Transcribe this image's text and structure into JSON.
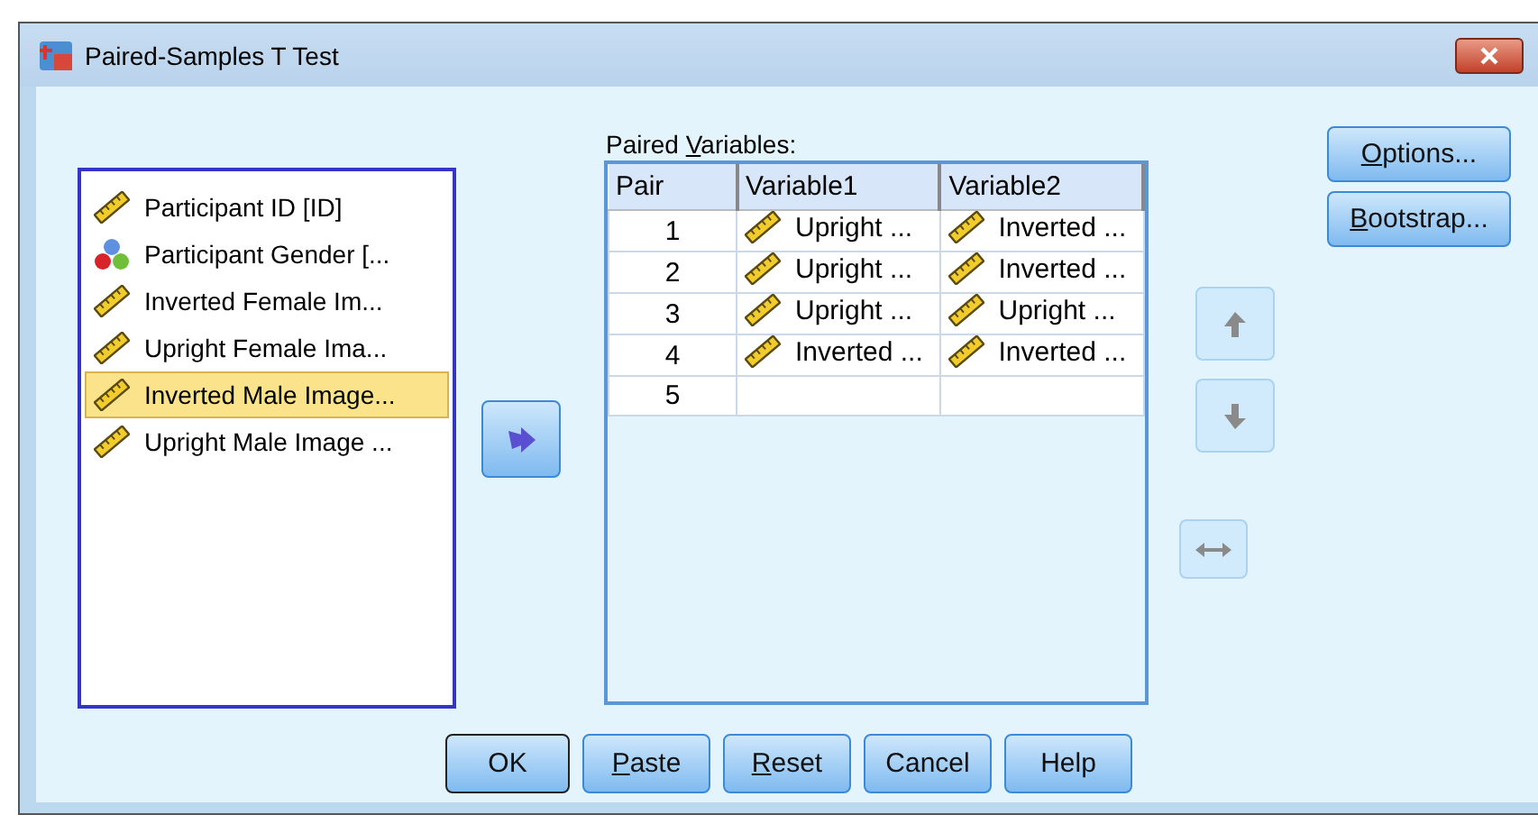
{
  "window": {
    "title": "Paired-Samples T Test"
  },
  "variables": [
    {
      "label": "Participant ID [ID]",
      "kind": "scale",
      "selected": false
    },
    {
      "label": "Participant Gender [...",
      "kind": "nominal",
      "selected": false
    },
    {
      "label": "Inverted Female Im...",
      "kind": "scale",
      "selected": false
    },
    {
      "label": "Upright Female Ima...",
      "kind": "scale",
      "selected": false
    },
    {
      "label": "Inverted Male Image...",
      "kind": "scale",
      "selected": true
    },
    {
      "label": "Upright Male Image ...",
      "kind": "scale",
      "selected": false
    }
  ],
  "paired_variables": {
    "label": {
      "pre": "Paired ",
      "key": "V",
      "post": "ariables:"
    },
    "columns": [
      "Pair",
      "Variable1",
      "Variable2"
    ],
    "rows": [
      [
        {
          "text": "1"
        },
        {
          "text": "Upright ...",
          "kind": "scale"
        },
        {
          "text": "Inverted ...",
          "kind": "scale"
        }
      ],
      [
        {
          "text": "2"
        },
        {
          "text": "Upright ...",
          "kind": "scale"
        },
        {
          "text": "Inverted ...",
          "kind": "scale"
        }
      ],
      [
        {
          "text": "3"
        },
        {
          "text": "Upright ...",
          "kind": "scale"
        },
        {
          "text": "Upright ...",
          "kind": "scale"
        }
      ],
      [
        {
          "text": "4"
        },
        {
          "text": "Inverted ...",
          "kind": "scale"
        },
        {
          "text": "Inverted ...",
          "kind": "scale"
        }
      ],
      [
        {
          "text": "5"
        },
        {
          "text": ""
        },
        {
          "text": ""
        }
      ]
    ]
  },
  "move_button": {
    "disabled": false
  },
  "order_buttons": {
    "up": {
      "disabled": true
    },
    "down": {
      "disabled": true
    },
    "swap": {
      "disabled": true
    }
  },
  "side_buttons": [
    {
      "label": {
        "key": "O",
        "post": "ptions..."
      }
    },
    {
      "label": {
        "key": "B",
        "post": "ootstrap..."
      }
    }
  ],
  "buttons": [
    {
      "label": {
        "pre": "OK"
      },
      "default": true
    },
    {
      "label": {
        "key": "P",
        "post": "aste"
      },
      "default": false
    },
    {
      "label": {
        "key": "R",
        "post": "eset"
      },
      "default": false
    },
    {
      "label": {
        "pre": "Cancel"
      },
      "default": false
    },
    {
      "label": {
        "pre": "Help"
      },
      "default": false
    }
  ]
}
